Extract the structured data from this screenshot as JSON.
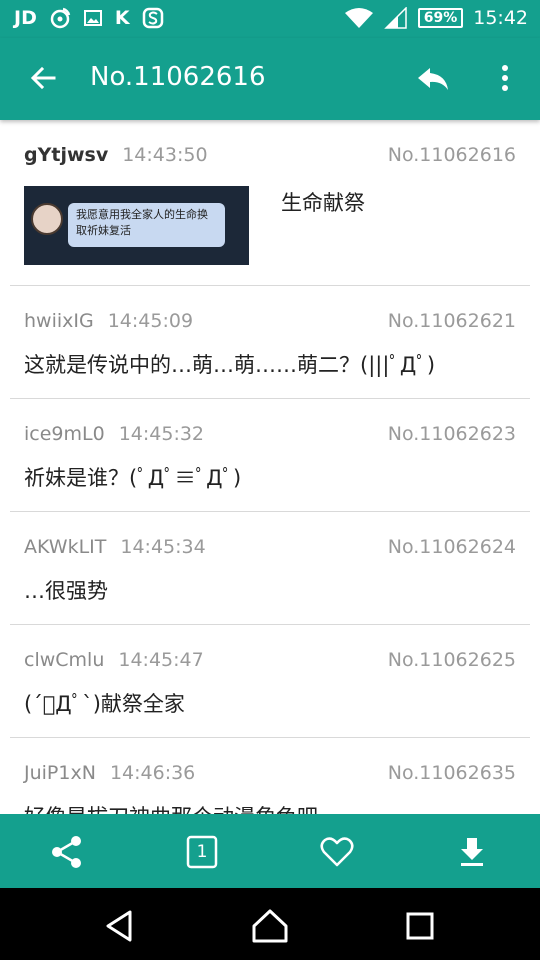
{
  "status_bar": {
    "left_icons": [
      "JD",
      "weibo-icon",
      "image-icon",
      "K",
      "S"
    ],
    "battery": "69%",
    "time": "15:42"
  },
  "appbar": {
    "title": "No.11062616"
  },
  "posts": [
    {
      "uid": "gYtjwsv",
      "time": "14:43:50",
      "pid": "No.11062616",
      "image_text": "我愿意用我全家人的生命换取祈妹复活",
      "text": "生命献祭"
    },
    {
      "uid": "hwiixIG",
      "time": "14:45:09",
      "pid": "No.11062621",
      "text": "这就是传说中的…萌…萌……萌二？(|||ﾟДﾟ)"
    },
    {
      "uid": "ice9mL0",
      "time": "14:45:32",
      "pid": "No.11062623",
      "text": "祈妹是谁？(ﾟДﾟ≡ﾟДﾟ)"
    },
    {
      "uid": "AKWkLIT",
      "time": "14:45:34",
      "pid": "No.11062624",
      "text": "…很强势"
    },
    {
      "uid": "clwCmlu",
      "time": "14:45:47",
      "pid": "No.11062625",
      "text": "(´ﾟДﾟ`)献祭全家"
    },
    {
      "uid": "JuiP1xN",
      "time": "14:46:36",
      "pid": "No.11062635",
      "text": "好像是拔刀神曲那个动漫角色吧"
    }
  ],
  "bottom_bar": {
    "page_number": "1"
  },
  "colors": {
    "primary": "#14a08e"
  }
}
